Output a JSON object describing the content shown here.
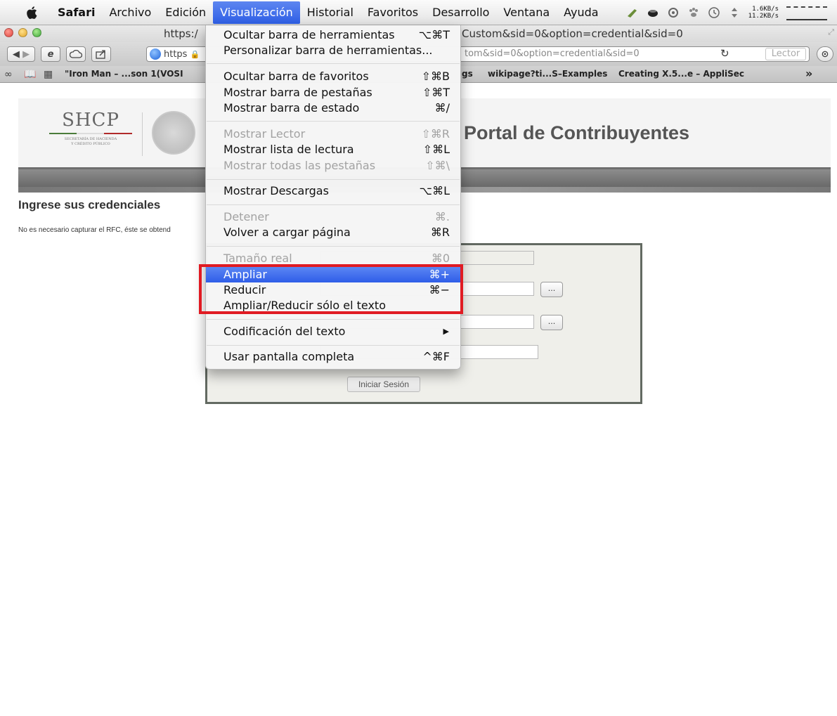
{
  "menubar": {
    "app_name": "Safari",
    "items": [
      "Archivo",
      "Edición",
      "Visualización",
      "Historial",
      "Favoritos",
      "Desarrollo",
      "Ventana",
      "Ayuda"
    ],
    "net_up": "1.6KB/s",
    "net_down": "11.2KB/s"
  },
  "window": {
    "title_left": "https:/",
    "title_right": "Custom&sid=0&option=credential&sid=0"
  },
  "toolbar": {
    "url_prefix": "https",
    "url_suffix": "tom&sid=0&option=credential&sid=0",
    "lector": "Lector"
  },
  "bookmarks": {
    "items": [
      "\"Iron Man – ...son 1(VOSI",
      "gs",
      "wikipage?ti...S–Examples",
      "Creating X.5...e – AppliSec"
    ],
    "more": "»"
  },
  "page": {
    "shcp_title": "SHCP",
    "shcp_sub1": "SECRETARÍA DE HACIENDA",
    "shcp_sub2": "Y CRÉDITO PÚBLICO",
    "portal_title": "Portal de Contribuyentes",
    "heading": "Ingrese sus credenciales",
    "note": "No es necesario capturar el RFC, éste se obtend",
    "browse_label": "...",
    "submit_label": "Iniciar Sesión"
  },
  "dropdown": {
    "items": [
      {
        "label": "Ocultar barra de herramientas",
        "shortcut": "⌥⌘T",
        "disabled": false
      },
      {
        "label": "Personalizar barra de herramientas...",
        "shortcut": "",
        "disabled": false
      },
      {
        "label": "Ocultar barra de favoritos",
        "shortcut": "⇧⌘B",
        "disabled": false
      },
      {
        "label": "Mostrar barra de pestañas",
        "shortcut": "⇧⌘T",
        "disabled": false
      },
      {
        "label": "Mostrar barra de estado",
        "shortcut": "⌘/",
        "disabled": false
      },
      {
        "label": "Mostrar Lector",
        "shortcut": "⇧⌘R",
        "disabled": true
      },
      {
        "label": "Mostrar lista de lectura",
        "shortcut": "⇧⌘L",
        "disabled": false
      },
      {
        "label": "Mostrar todas las pestañas",
        "shortcut": "⇧⌘\\",
        "disabled": true
      },
      {
        "label": "Mostrar Descargas",
        "shortcut": "⌥⌘L",
        "disabled": false
      },
      {
        "label": "Detener",
        "shortcut": "⌘.",
        "disabled": true
      },
      {
        "label": "Volver a cargar página",
        "shortcut": "⌘R",
        "disabled": false
      },
      {
        "label": "Tamaño real",
        "shortcut": "⌘0",
        "disabled": true
      },
      {
        "label": "Ampliar",
        "shortcut": "⌘+",
        "disabled": false,
        "highlighted": true
      },
      {
        "label": "Reducir",
        "shortcut": "⌘−",
        "disabled": false
      },
      {
        "label": "Ampliar/Reducir sólo el texto",
        "shortcut": "",
        "disabled": false
      },
      {
        "label": "Codificación del texto",
        "shortcut": "",
        "disabled": false,
        "submenu": true
      },
      {
        "label": "Usar pantalla completa",
        "shortcut": "^⌘F",
        "disabled": false
      }
    ]
  },
  "colors": {
    "highlight": "#3a66ea",
    "annotation_box": "#e01b23"
  }
}
